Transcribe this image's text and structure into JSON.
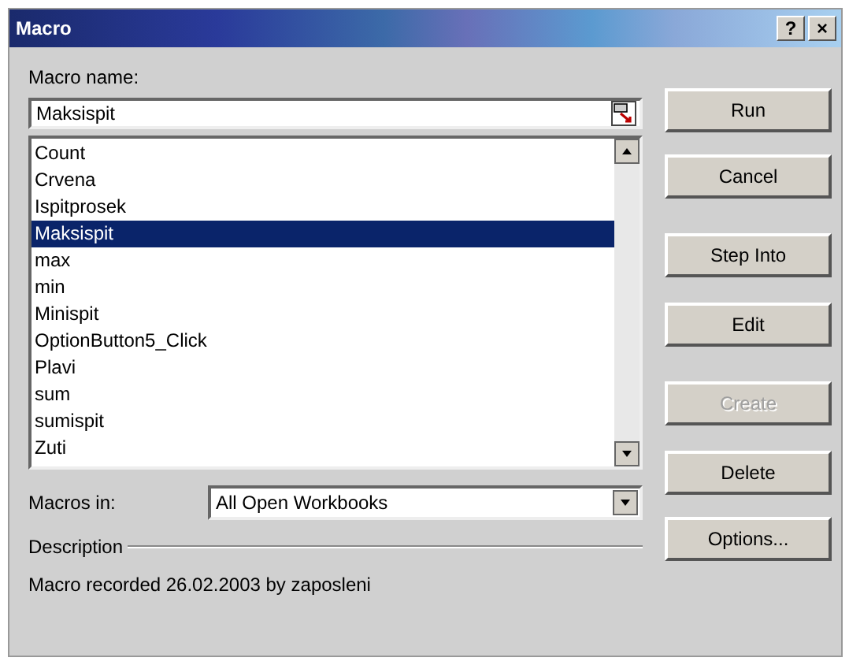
{
  "window": {
    "title": "Macro",
    "help": "?",
    "close": "×"
  },
  "macro_name": {
    "label": "Macro name:",
    "value": "Maksispit"
  },
  "macros": [
    {
      "name": "Count",
      "selected": false
    },
    {
      "name": "Crvena",
      "selected": false
    },
    {
      "name": "Ispitprosek",
      "selected": false
    },
    {
      "name": "Maksispit",
      "selected": true
    },
    {
      "name": "max",
      "selected": false
    },
    {
      "name": "min",
      "selected": false
    },
    {
      "name": "Minispit",
      "selected": false
    },
    {
      "name": "OptionButton5_Click",
      "selected": false
    },
    {
      "name": "Plavi",
      "selected": false
    },
    {
      "name": "sum",
      "selected": false
    },
    {
      "name": "sumispit",
      "selected": false
    },
    {
      "name": "Zuti",
      "selected": false
    }
  ],
  "macros_in": {
    "label": "Macros in:",
    "value": "All Open Workbooks"
  },
  "description": {
    "label": "Description",
    "text": "Macro recorded 26.02.2003 by zaposleni"
  },
  "buttons": [
    {
      "label": "Run",
      "disabled": false
    },
    {
      "label": "Cancel",
      "disabled": false
    },
    {
      "label": "Step Into",
      "disabled": false
    },
    {
      "label": "Edit",
      "disabled": false
    },
    {
      "label": "Create",
      "disabled": true
    },
    {
      "label": "Delete",
      "disabled": false
    },
    {
      "label": "Options...",
      "disabled": false
    }
  ]
}
